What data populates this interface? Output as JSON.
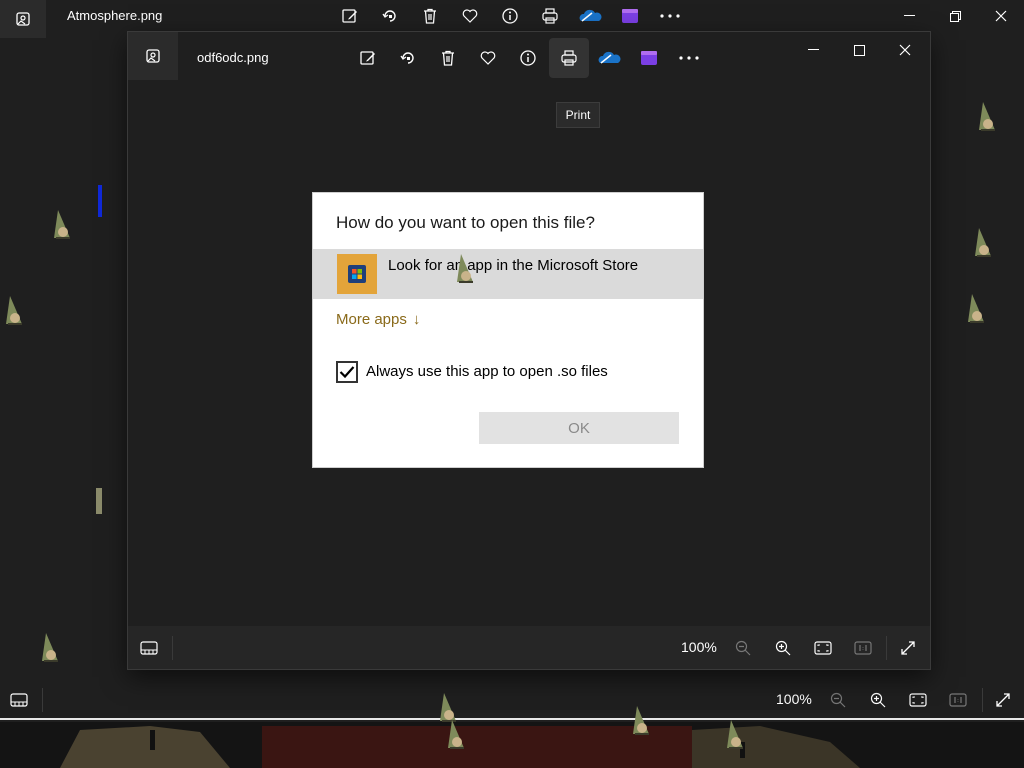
{
  "outer_window": {
    "title": "Atmosphere.png",
    "toolbar_icons": [
      "edit-icon",
      "rotate-icon",
      "delete-icon",
      "favorite-icon",
      "info-icon",
      "print-icon",
      "onedrive-icon",
      "video-editor-icon",
      "more-icon"
    ],
    "bottom_bar": {
      "zoom_label": "100%"
    }
  },
  "inner_window": {
    "title": "odf6odc.png",
    "tooltip": "Print",
    "bottom_bar": {
      "zoom_label": "100%"
    }
  },
  "dialog": {
    "title": "How do you want to open this file?",
    "store_option": "Look for an app in the Microsoft Store",
    "more_apps": "More apps",
    "more_apps_arrow": "↓",
    "always_use": "Always use this app to open .so files",
    "always_checked": true,
    "ok_label": "OK"
  },
  "colors": {
    "background": "#1f1f1f",
    "dialog_bg": "#ffffff",
    "store_row_bg": "#dadada",
    "more_apps_link": "#8a6a1a",
    "store_icon_bg": "#e3a43a"
  }
}
